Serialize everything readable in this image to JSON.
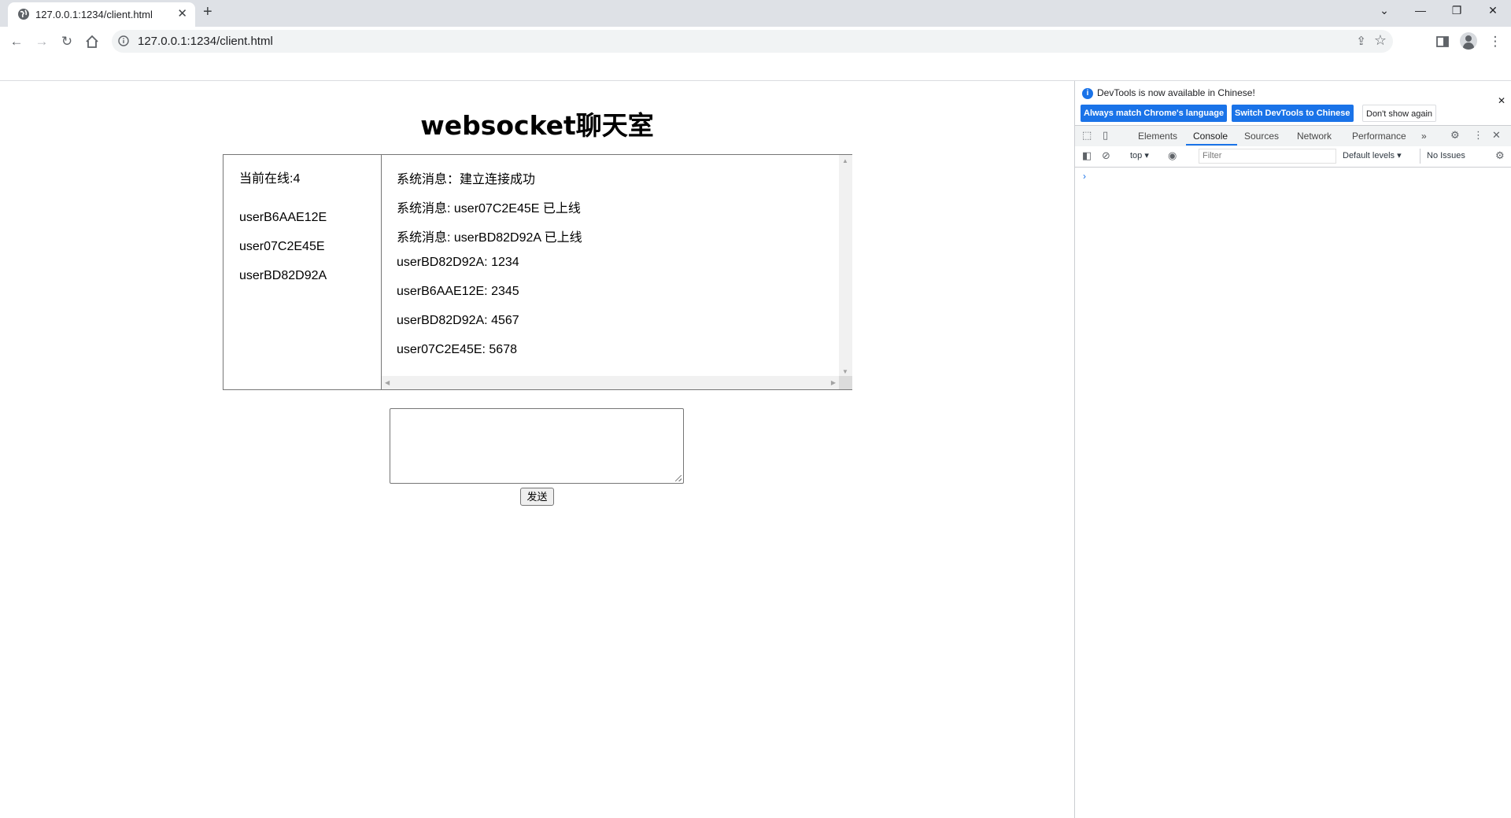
{
  "browser": {
    "tab_title": "127.0.0.1:1234/client.html",
    "tab_close": "✕",
    "new_tab": "+",
    "url": "127.0.0.1:1234/client.html",
    "window_controls": {
      "dropdown": "⌄",
      "minimize": "—",
      "restore": "❐",
      "close": "✕"
    }
  },
  "page": {
    "title": "websocket聊天室",
    "online_count": "当前在线:4",
    "online_users": [
      "userB6AAE12E",
      "user07C2E45E",
      "userBD82D92A"
    ],
    "messages": [
      "系统消息：建立连接成功",
      "系统消息: user07C2E45E 已上线",
      "系统消息: userBD82D92A 已上线",
      "userBD82D92A: 1234",
      "userB6AAE12E: 2345",
      "userBD82D92A: 4567",
      "user07C2E45E: 5678"
    ],
    "input_value": "",
    "send_label": "发送"
  },
  "devtools": {
    "banner_text": "DevTools is now available in Chinese!",
    "btn_match": "Always match Chrome's language",
    "btn_switch": "Switch DevTools to Chinese",
    "btn_dismiss": "Don't show again",
    "tabs": [
      "Elements",
      "Console",
      "Sources",
      "Network",
      "Performance"
    ],
    "active_tab": "Console",
    "more_tabs": "»",
    "context": "top",
    "filter_placeholder": "Filter",
    "levels": "Default levels",
    "issues": "No Issues",
    "prompt": "›"
  },
  "colors": {
    "accent": "#1a73e8",
    "tabstrip": "#dee1e6",
    "omnibox": "#f1f3f4"
  }
}
